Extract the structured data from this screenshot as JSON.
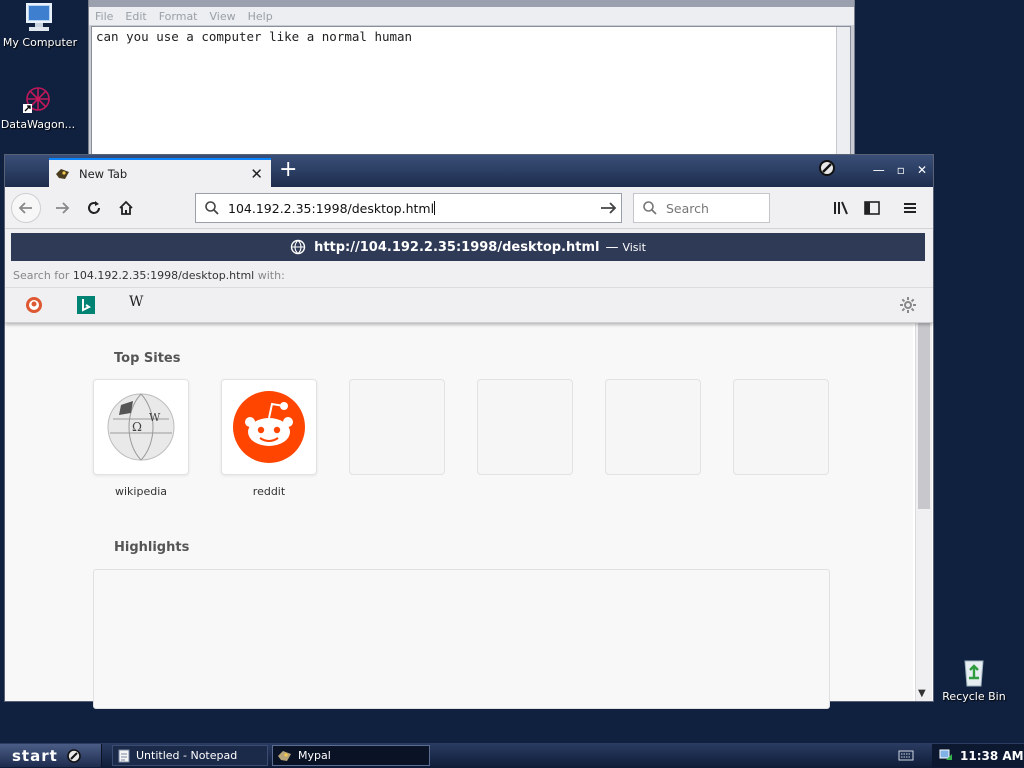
{
  "desktop": {
    "icons": [
      {
        "label": "My Computer"
      },
      {
        "label": "DataWagon..."
      },
      {
        "label": "Recycle Bin"
      }
    ]
  },
  "notepad": {
    "menu": [
      "File",
      "Edit",
      "Format",
      "View",
      "Help"
    ],
    "text": "can you use a computer like a normal human"
  },
  "browser": {
    "tab_title": "New Tab",
    "url_value": "104.192.2.35:1998/desktop.html",
    "search_placeholder": "Search",
    "popup": {
      "visit_url": "http://104.192.2.35:1998/desktop.html",
      "dash": "—",
      "visit_label": "Visit",
      "search_for_prefix": "Search for",
      "search_for_query": "104.192.2.35:1998/desktop.html",
      "search_for_suffix": "with:",
      "wiki_letter": "W"
    },
    "newtab": {
      "top_sites_title": "Top Sites",
      "highlights_title": "Highlights",
      "sites": [
        {
          "label": "wikipedia",
          "icon": "wikipedia-globe"
        },
        {
          "label": "reddit",
          "icon": "reddit-alien"
        },
        {
          "label": ""
        },
        {
          "label": ""
        },
        {
          "label": ""
        },
        {
          "label": ""
        }
      ]
    }
  },
  "taskbar": {
    "start_label": "start",
    "tasks": [
      {
        "label": "Untitled - Notepad"
      },
      {
        "label": "Mypal"
      }
    ],
    "clock": "11:38 AM"
  },
  "colors": {
    "desktop": "#10213f",
    "reddit": "#ff4500",
    "visit_row": "#2f3a56"
  }
}
